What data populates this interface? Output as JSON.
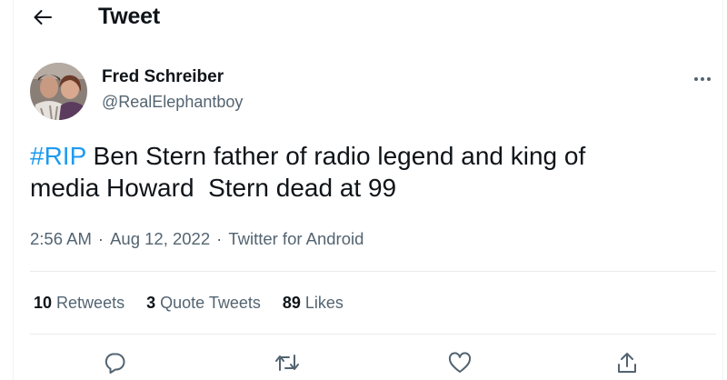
{
  "header": {
    "title": "Tweet"
  },
  "author": {
    "name": "Fred Schreiber",
    "handle": "@RealElephantboy"
  },
  "tweet": {
    "hashtag": "#RIP",
    "text_line1": " Ben Stern father of radio legend and king of",
    "text_line2": "media Howard  Stern dead at 99"
  },
  "meta": {
    "time": "2:56 AM",
    "separator": "·",
    "date": "Aug 12, 2022",
    "source": "Twitter for Android"
  },
  "stats": {
    "retweets_count": "10",
    "retweets_label": "Retweets",
    "quotes_count": "3",
    "quotes_label": "Quote Tweets",
    "likes_count": "89",
    "likes_label": "Likes"
  },
  "icons": {
    "back": "arrow-left-icon",
    "more": "more-dots-icon",
    "reply": "reply-bubble-icon",
    "retweet": "retweet-icon",
    "like": "heart-icon",
    "share": "share-icon"
  },
  "colors": {
    "accent": "#1d9bf0",
    "text": "#0f1419",
    "secondary": "#536471",
    "divider": "#e8ebed"
  }
}
